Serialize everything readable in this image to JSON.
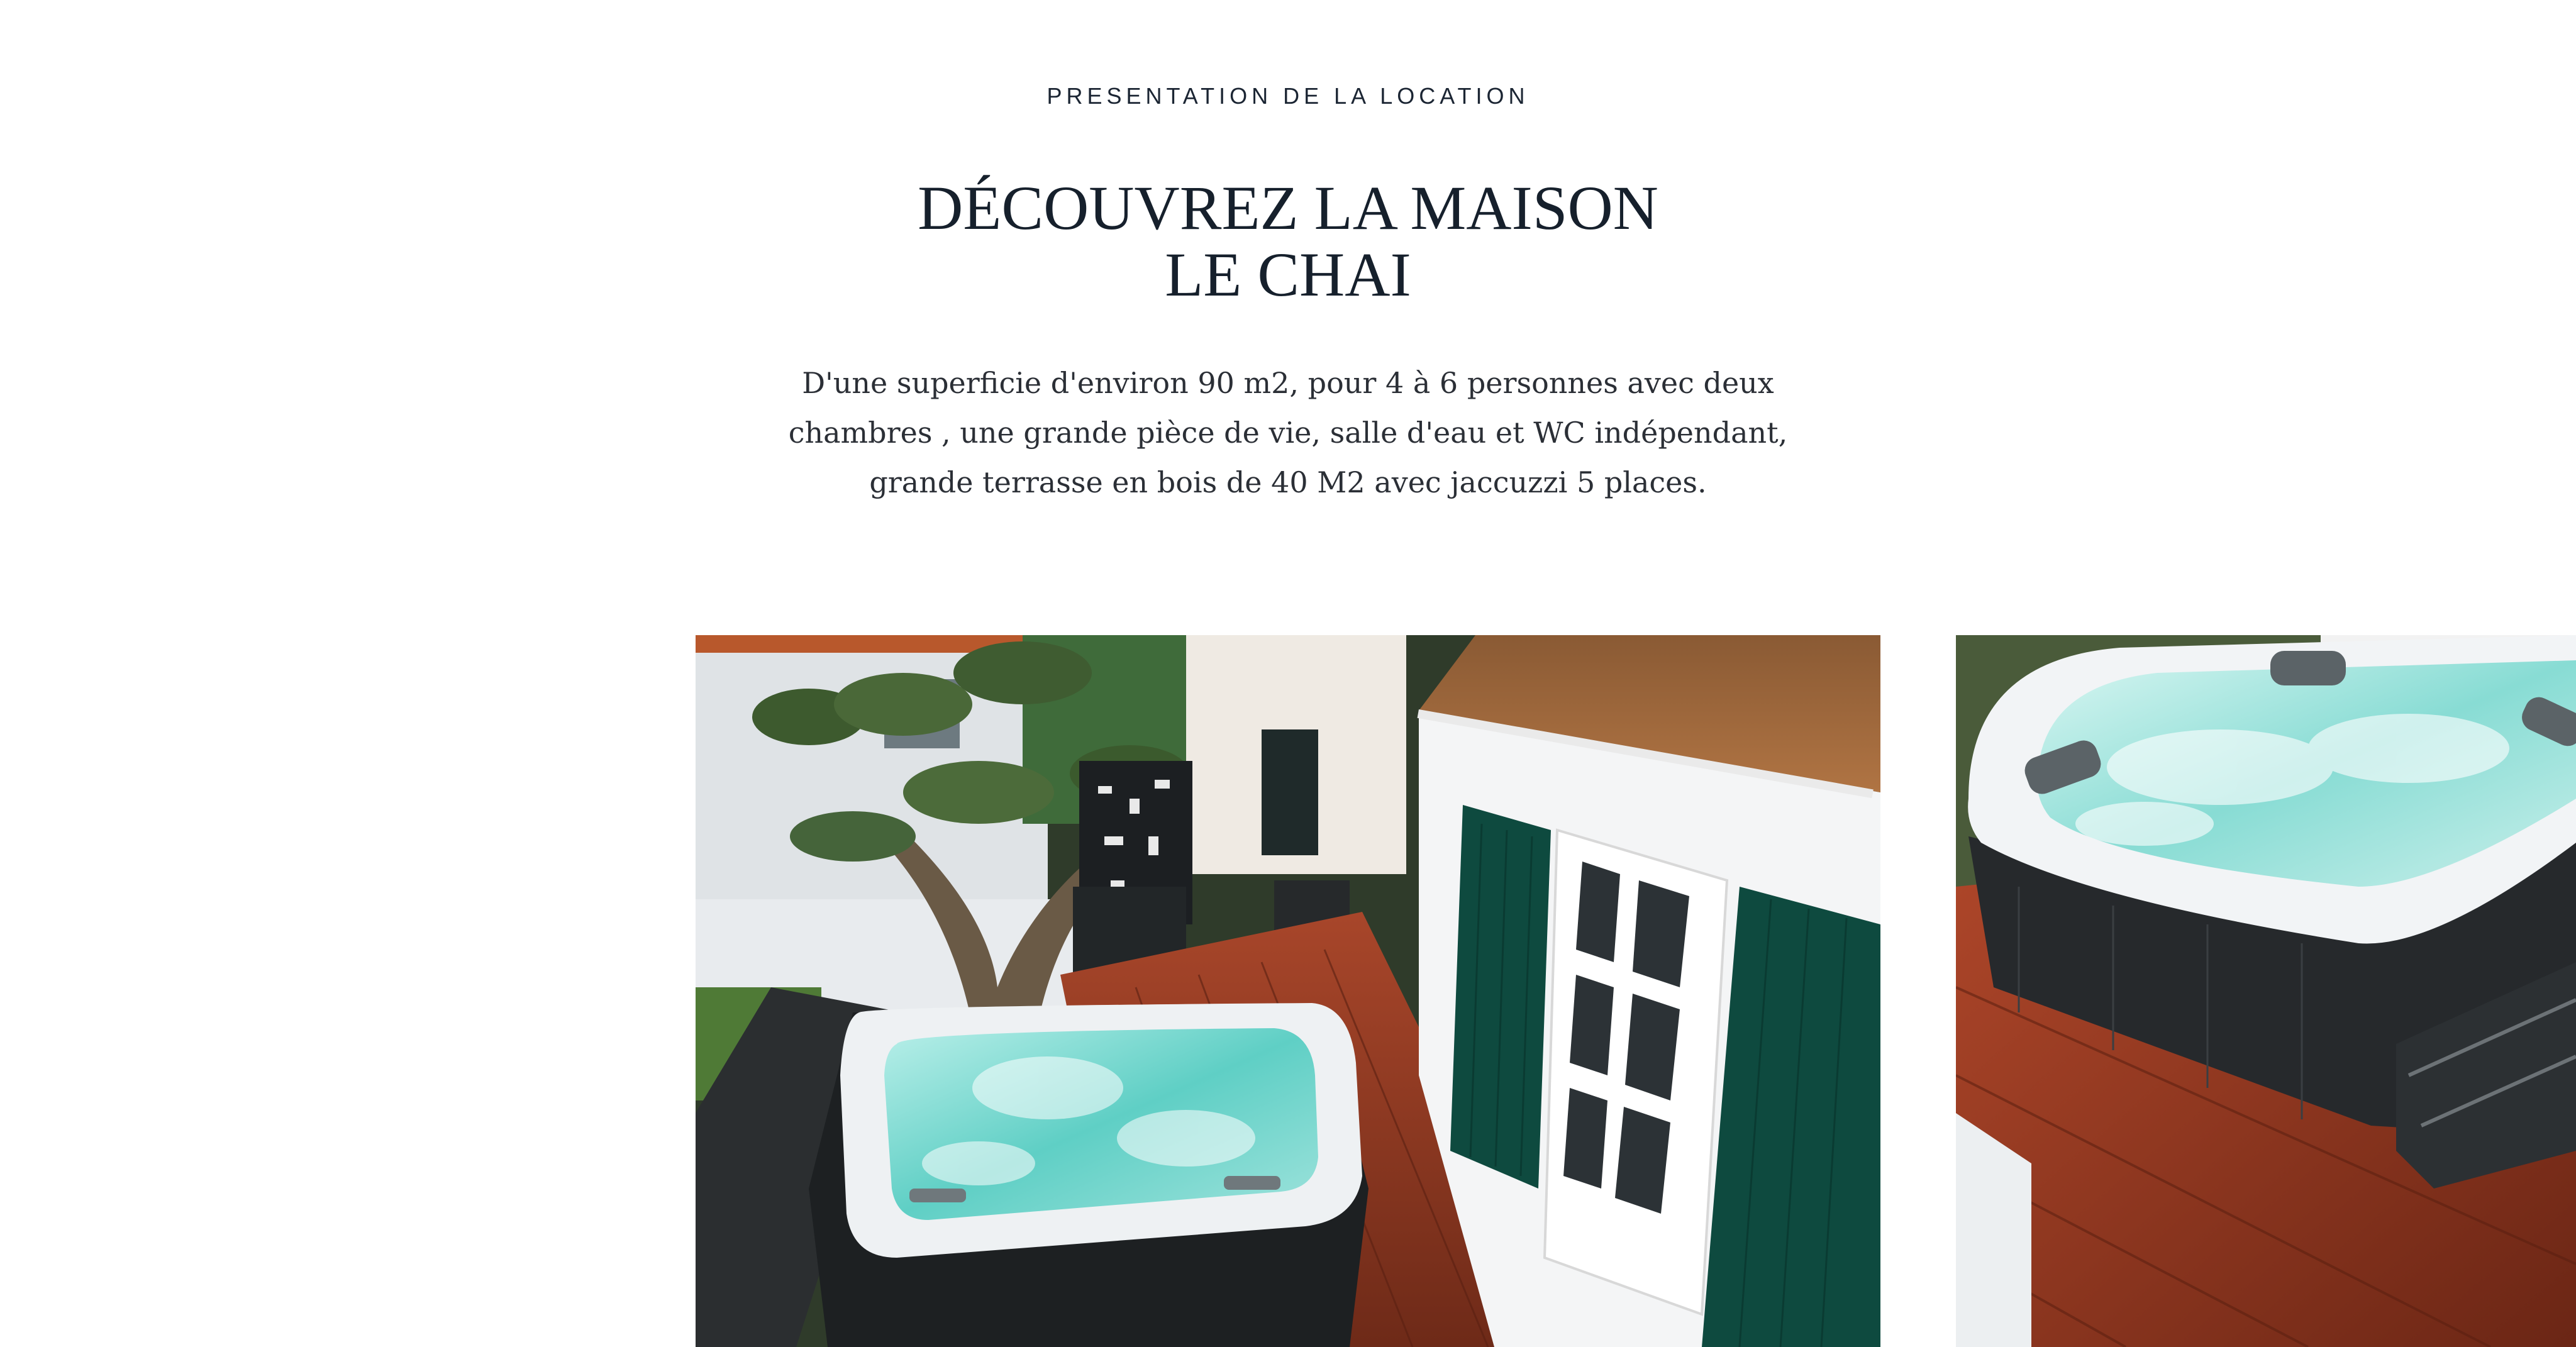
{
  "section": {
    "eyebrow": "PRESENTATION DE LA LOCATION",
    "heading_line1": "DÉCOUVREZ LA MAISON",
    "heading_line2": "LE CHAI",
    "description": "D'une superficie d'environ 90 m2, pour 4 à 6 personnes avec deux chambres , une grande pièce de vie, salle d'eau et WC indépendant, grande terrasse en bois de 40 M2 avec jaccuzzi 5 places."
  },
  "colors": {
    "text_dark": "#16202c",
    "body_text": "#2b2f36",
    "background": "#ffffff",
    "shutter_green": "#0e4a3f",
    "deck_wood": "#8e3a22",
    "spa_water": "#7fd6d0"
  }
}
